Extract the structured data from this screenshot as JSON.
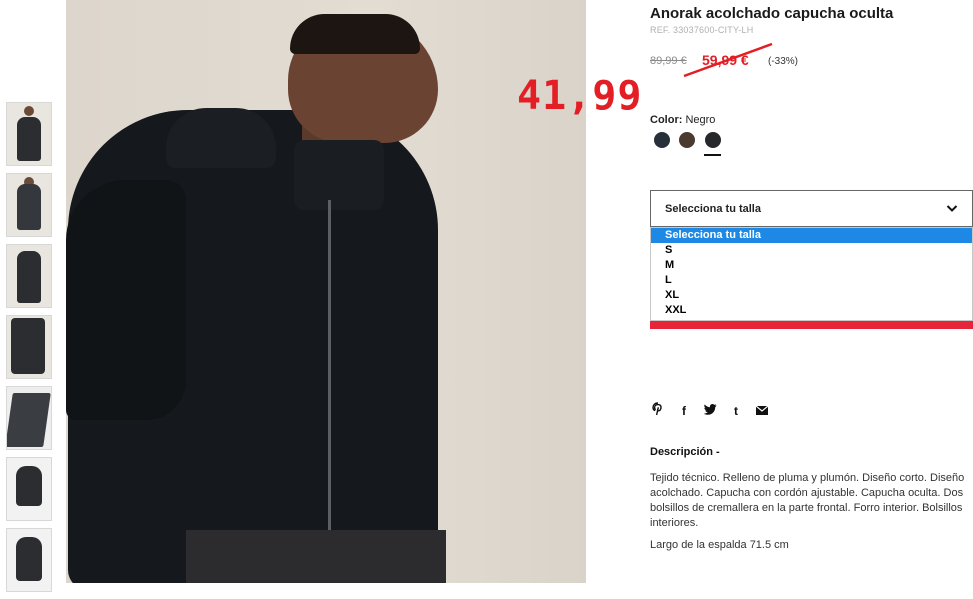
{
  "product": {
    "title": "Anorak acolchado capucha oculta",
    "ref": "REF. 33037600-CITY-LH",
    "price_old": "89,99 €",
    "price_sale": "59,99 €",
    "discount": "(-33%)",
    "handwritten_price": "41,99"
  },
  "color": {
    "label": "Color:",
    "value": "Negro",
    "swatches": [
      {
        "name": "navy",
        "hex": "#27303a"
      },
      {
        "name": "brown",
        "hex": "#4a3a30"
      },
      {
        "name": "black",
        "hex": "#26282b",
        "selected": true
      }
    ]
  },
  "size_select": {
    "label": "Selecciona tu talla",
    "options": [
      "Selecciona tu talla",
      "S",
      "M",
      "L",
      "XL",
      "XXL"
    ],
    "selected": "Selecciona tu talla"
  },
  "social": {
    "icons": [
      "pinterest-icon",
      "facebook-icon",
      "twitter-icon",
      "tumblr-icon",
      "email-icon"
    ],
    "glyphs": [
      "℗",
      "f",
      "🐦",
      "t",
      "✉"
    ]
  },
  "description": {
    "title": "Descripción -",
    "text": "Tejido técnico. Relleno de pluma y plumón. Diseño corto. Diseño acolchado. Capucha con cordón ajustable. Capucha oculta. Dos bolsillos de cremallera en la parte frontal. Forro interior. Bolsillos interiores.",
    "length": "Largo de la espalda 71.5 cm"
  },
  "colors": {
    "accent_red": "#e31e24",
    "select_highlight": "#1e88e5"
  }
}
